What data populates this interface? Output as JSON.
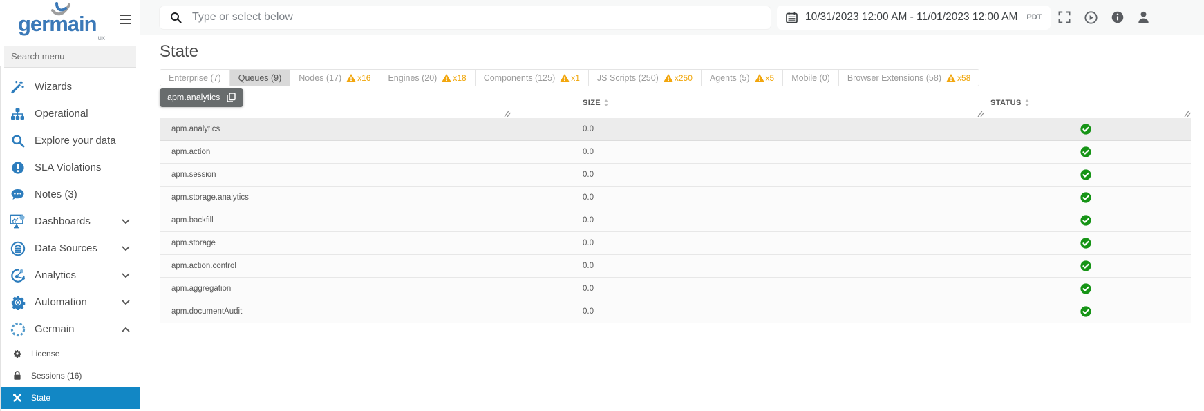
{
  "app": {
    "brand": "germain",
    "brand_sub": "ux"
  },
  "sidebar": {
    "search_placeholder": "Search menu",
    "items": [
      {
        "label": "Wizards",
        "icon": "wand-icon"
      },
      {
        "label": "Operational",
        "icon": "sitemap-icon"
      },
      {
        "label": "Explore your data",
        "icon": "search-icon"
      },
      {
        "label": "SLA Violations",
        "icon": "alert-circle-icon"
      },
      {
        "label": "Notes (3)",
        "icon": "comment-icon"
      },
      {
        "label": "Dashboards",
        "icon": "dashboard-icon",
        "expandable": true
      },
      {
        "label": "Data Sources",
        "icon": "database-icon",
        "expandable": true
      },
      {
        "label": "Analytics",
        "icon": "analytics-icon",
        "expandable": true
      },
      {
        "label": "Automation",
        "icon": "gear-icon",
        "expandable": true
      },
      {
        "label": "Germain",
        "icon": "dashed-circle-icon",
        "expanded": true
      }
    ],
    "sub_items": [
      {
        "label": "License",
        "icon": "license-gear-icon"
      },
      {
        "label": "Sessions (16)",
        "icon": "lock-icon"
      },
      {
        "label": "State",
        "icon": "tools-icon",
        "active": true
      }
    ]
  },
  "topbar": {
    "search_placeholder": "Type or select below",
    "date_range": "10/31/2023 12:00 AM - 11/01/2023 12:00 AM",
    "timezone": "PDT"
  },
  "main": {
    "title": "State",
    "tabs": [
      {
        "label": "Enterprise (7)"
      },
      {
        "label": "Queues (9)",
        "active": true
      },
      {
        "label": "Nodes (17)",
        "warning": "x16"
      },
      {
        "label": "Engines (20)",
        "warning": "x18"
      },
      {
        "label": "Components (125)",
        "warning": "x1"
      },
      {
        "label": "JS Scripts (250)",
        "warning": "x250"
      },
      {
        "label": "Agents (5)",
        "warning": "x5"
      },
      {
        "label": "Mobile (0)"
      },
      {
        "label": "Browser Extensions (58)",
        "warning": "x58"
      }
    ],
    "selected_tag": "apm.analytics",
    "table": {
      "columns": [
        "SIZE",
        "STATUS"
      ],
      "rows": [
        {
          "name": "apm.analytics",
          "size": "0.0",
          "status": "ok",
          "selected": true
        },
        {
          "name": "apm.action",
          "size": "0.0",
          "status": "ok"
        },
        {
          "name": "apm.session",
          "size": "0.0",
          "status": "ok"
        },
        {
          "name": "apm.storage.analytics",
          "size": "0.0",
          "status": "ok"
        },
        {
          "name": "apm.backfill",
          "size": "0.0",
          "status": "ok"
        },
        {
          "name": "apm.storage",
          "size": "0.0",
          "status": "ok"
        },
        {
          "name": "apm.action.control",
          "size": "0.0",
          "status": "ok"
        },
        {
          "name": "apm.aggregation",
          "size": "0.0",
          "status": "ok"
        },
        {
          "name": "apm.documentAudit",
          "size": "0.0",
          "status": "ok"
        }
      ]
    }
  },
  "colors": {
    "accent_blue": "#2d7dbd",
    "active_item_bg": "#1287c5",
    "warning_orange": "#f0a60a",
    "success_green": "#169416",
    "selected_tab_bg": "#d9d9d9",
    "chip_bg": "#686c6d"
  }
}
